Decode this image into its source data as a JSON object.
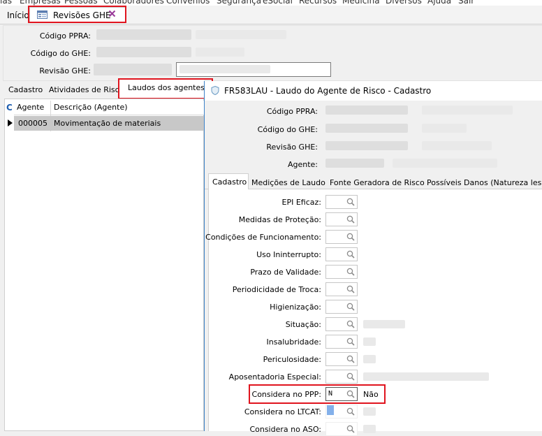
{
  "menu": [
    "ias",
    "Empresas",
    "Pessoas",
    "Colaboradores",
    "Convênios",
    "Segurança",
    "eSocial",
    "Recursos",
    "Medicina",
    "Diversos",
    "Ajuda",
    "Sair"
  ],
  "tabs": {
    "inicio": "Início",
    "revisoes": "Revisões GHE"
  },
  "header_form": {
    "codigo_ppra_label": "Código PPRA:",
    "codigo_ghe_label": "Código do GHE:",
    "revisao_ghe_label": "Revisão GHE:"
  },
  "left_tabs": [
    "Cadastro",
    "Atividades de Risco",
    "Laudos dos agentes de"
  ],
  "grid": {
    "col_agente": "Agente",
    "col_descricao": "Descrição (Agente)",
    "rows": [
      {
        "agente": "000005",
        "descricao": "Movimentação de materiais"
      }
    ]
  },
  "right_panel": {
    "title": "FR583LAU - Laudo do Agente de Risco - Cadastro",
    "labels": {
      "codigo_ppra": "Código PPRA:",
      "codigo_ghe": "Código do GHE:",
      "revisao_ghe": "Revisão GHE:",
      "agente": "Agente:"
    },
    "subtabs": [
      "Cadastro",
      "Medições de Laudo",
      "Fonte Geradora de Risco",
      "Possíveis Danos (Natureza lesões"
    ],
    "fields": [
      {
        "label": "EPI Eficaz:"
      },
      {
        "label": "Medidas de Proteção:"
      },
      {
        "label": "Condições de Funcionamento:"
      },
      {
        "label": "Uso Ininterrupto:"
      },
      {
        "label": "Prazo de Validade:"
      },
      {
        "label": "Periodicidade de Troca:"
      },
      {
        "label": "Higienização:"
      },
      {
        "label": "Situação:"
      },
      {
        "label": "Insalubridade:"
      },
      {
        "label": "Periculosidade:"
      },
      {
        "label": "Aposentadoria Especial:"
      },
      {
        "label": "Considera no PPP:",
        "value": "N",
        "desc": "Não"
      },
      {
        "label": "Considera no LTCAT:"
      },
      {
        "label": "Considera no ASO:"
      }
    ]
  },
  "colors": {
    "highlight": "#e0141e",
    "selected_row": "#c8c8c8",
    "focus_blue": "#1e6fd9"
  }
}
